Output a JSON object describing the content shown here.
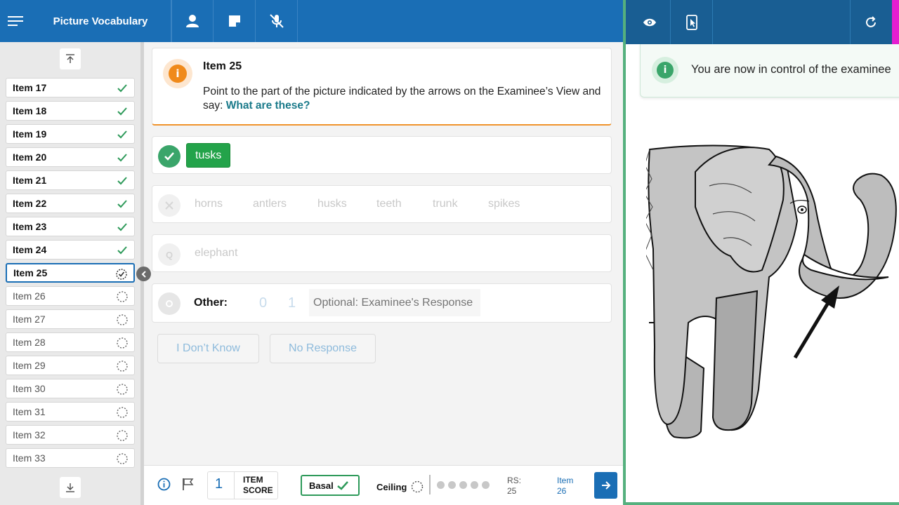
{
  "app": {
    "title": "Picture Vocabulary",
    "toolbar_icons": [
      "menu-icon",
      "person-icon",
      "note-icon",
      "mic-off-icon"
    ]
  },
  "sidebar": {
    "items": [
      {
        "label": "Item 17",
        "status": "done"
      },
      {
        "label": "Item 18",
        "status": "done"
      },
      {
        "label": "Item 19",
        "status": "done"
      },
      {
        "label": "Item 20",
        "status": "done"
      },
      {
        "label": "Item 21",
        "status": "done"
      },
      {
        "label": "Item 22",
        "status": "done"
      },
      {
        "label": "Item 23",
        "status": "done"
      },
      {
        "label": "Item 24",
        "status": "done"
      },
      {
        "label": "Item 25",
        "status": "current"
      },
      {
        "label": "Item 26",
        "status": "pending"
      },
      {
        "label": "Item 27",
        "status": "pending"
      },
      {
        "label": "Item 28",
        "status": "pending"
      },
      {
        "label": "Item 29",
        "status": "pending"
      },
      {
        "label": "Item 30",
        "status": "pending"
      },
      {
        "label": "Item 31",
        "status": "pending"
      },
      {
        "label": "Item 32",
        "status": "pending"
      },
      {
        "label": "Item 33",
        "status": "pending"
      }
    ]
  },
  "prompt": {
    "heading": "Item 25",
    "instruction": "Point to the part of the picture indicated by the arrows on the Examinee’s View and say:",
    "cue": "What are these?"
  },
  "correct": {
    "answer": "tusks"
  },
  "incorrect": {
    "options": [
      "horns",
      "antlers",
      "husks",
      "teeth",
      "trunk",
      "spikes"
    ]
  },
  "query": {
    "options": [
      "elephant"
    ]
  },
  "other": {
    "label": "Other:",
    "score_options": [
      "0",
      "1"
    ],
    "placeholder": "Optional: Examinee's Response"
  },
  "actions": {
    "dont_know": "I Don’t Know",
    "no_response": "No Response"
  },
  "bottom": {
    "item_score_value": "1",
    "item_score_label": "ITEM SCORE",
    "basal_label": "Basal",
    "ceiling_label": "Ceiling",
    "rs_label": "RS:",
    "rs_value": "25",
    "next_item_label": "Item",
    "next_item_value": "26"
  },
  "examinee_view": {
    "notice": "You are now in control of the examinee"
  },
  "colors": {
    "primary": "#1a6eb5",
    "success": "#23a34a",
    "warning": "#f08a1a",
    "pane_border": "#55b07e"
  }
}
